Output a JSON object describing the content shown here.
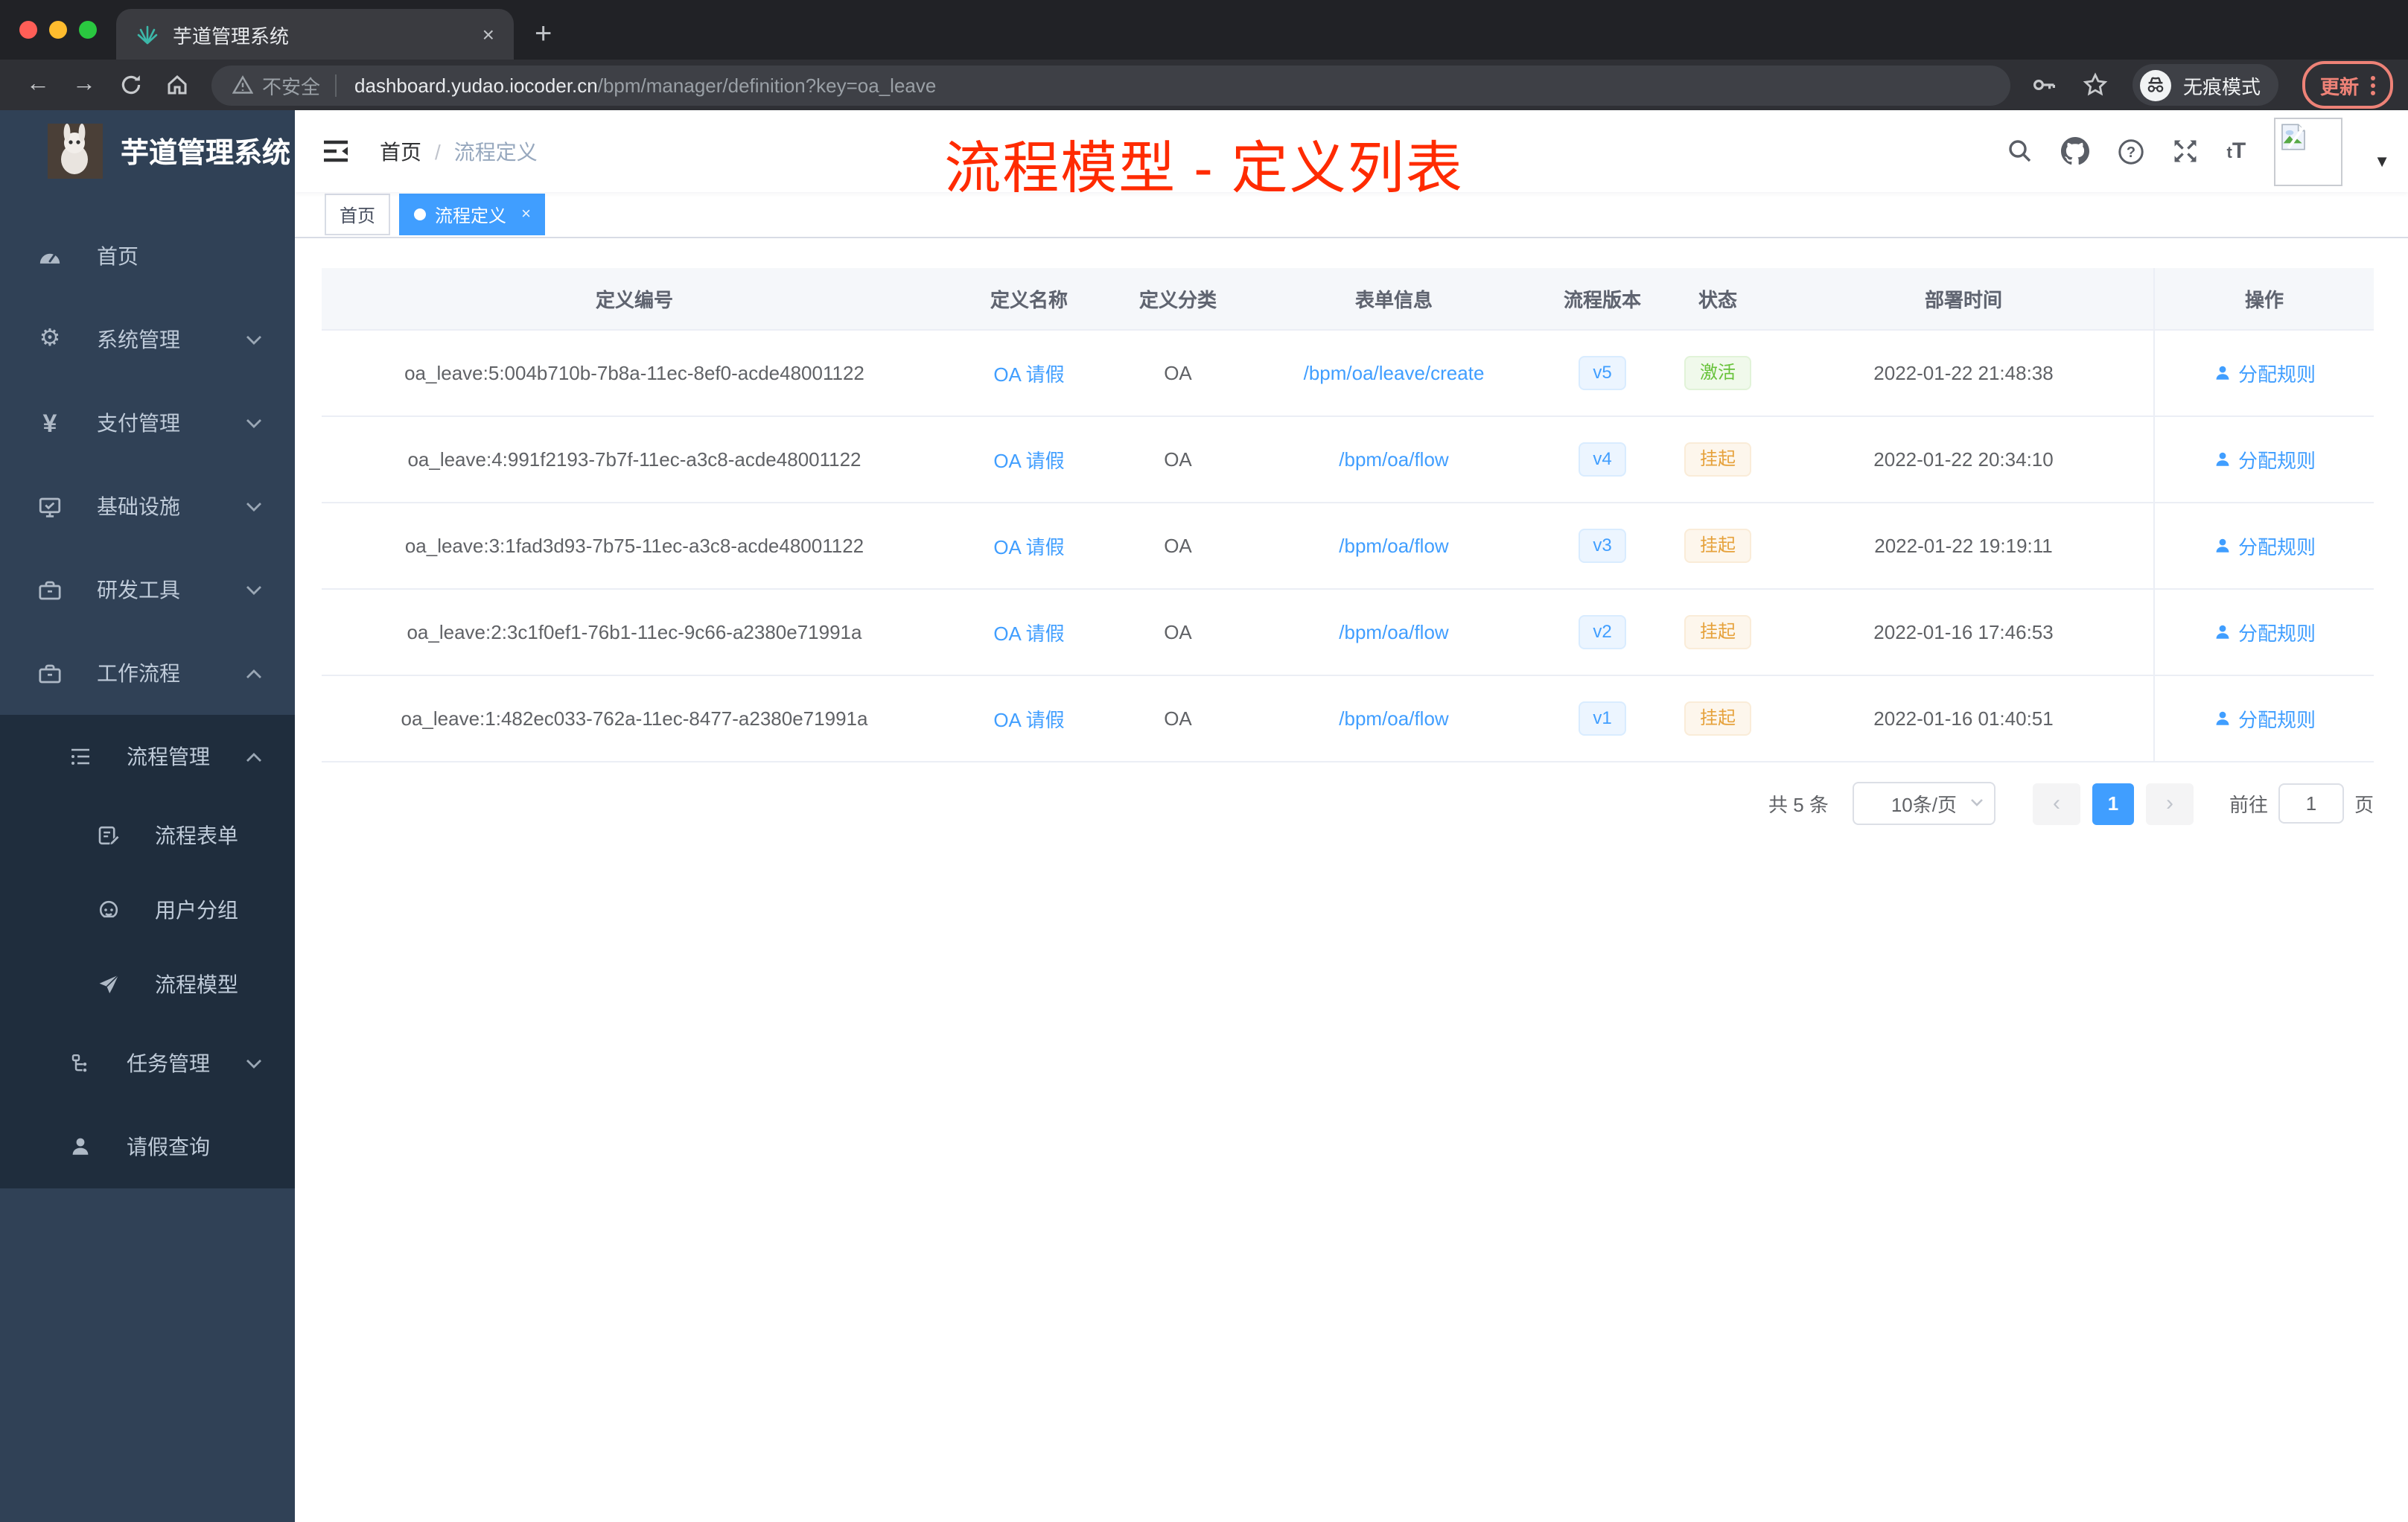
{
  "browser": {
    "tab": {
      "title": "芋道管理系统",
      "close": "×",
      "new_tab": "+"
    },
    "nav": {
      "back": "←",
      "forward": "→"
    },
    "address": {
      "security": "不安全",
      "host": "dashboard.yudao.iocoder.cn",
      "path": "/bpm/manager/definition?key=oa_leave"
    },
    "incognito_label": "无痕模式",
    "update_label": "更新"
  },
  "sidebar": {
    "title": "芋道管理系统",
    "items": [
      {
        "label": "首页"
      },
      {
        "label": "系统管理"
      },
      {
        "label": "支付管理"
      },
      {
        "label": "基础设施"
      },
      {
        "label": "研发工具"
      },
      {
        "label": "工作流程"
      }
    ],
    "workflow_children": [
      {
        "label": "流程管理"
      },
      {
        "label": "流程表单"
      },
      {
        "label": "用户分组"
      },
      {
        "label": "流程模型"
      },
      {
        "label": "任务管理"
      },
      {
        "label": "请假查询"
      }
    ]
  },
  "header": {
    "breadcrumb": [
      "首页",
      "流程定义"
    ],
    "breadcrumb_sep": "/",
    "overlay_title": "流程模型 - 定义列表",
    "font_icon": "tT"
  },
  "tags": {
    "home": "首页",
    "active": "流程定义",
    "close": "×"
  },
  "table": {
    "columns": [
      "定义编号",
      "定义名称",
      "定义分类",
      "表单信息",
      "流程版本",
      "状态",
      "部署时间",
      "操作"
    ],
    "action_label": "分配规则",
    "rows": [
      {
        "id": "oa_leave:5:004b710b-7b8a-11ec-8ef0-acde48001122",
        "name": "OA 请假",
        "category": "OA",
        "form": "/bpm/oa/leave/create",
        "version": "v5",
        "status": "激活",
        "status_type": "success",
        "time": "2022-01-22 21:48:38"
      },
      {
        "id": "oa_leave:4:991f2193-7b7f-11ec-a3c8-acde48001122",
        "name": "OA 请假",
        "category": "OA",
        "form": "/bpm/oa/flow",
        "version": "v4",
        "status": "挂起",
        "status_type": "warning",
        "time": "2022-01-22 20:34:10"
      },
      {
        "id": "oa_leave:3:1fad3d93-7b75-11ec-a3c8-acde48001122",
        "name": "OA 请假",
        "category": "OA",
        "form": "/bpm/oa/flow",
        "version": "v3",
        "status": "挂起",
        "status_type": "warning",
        "time": "2022-01-22 19:19:11"
      },
      {
        "id": "oa_leave:2:3c1f0ef1-76b1-11ec-9c66-a2380e71991a",
        "name": "OA 请假",
        "category": "OA",
        "form": "/bpm/oa/flow",
        "version": "v2",
        "status": "挂起",
        "status_type": "warning",
        "time": "2022-01-16 17:46:53"
      },
      {
        "id": "oa_leave:1:482ec033-762a-11ec-8477-a2380e71991a",
        "name": "OA 请假",
        "category": "OA",
        "form": "/bpm/oa/flow",
        "version": "v1",
        "status": "挂起",
        "status_type": "warning",
        "time": "2022-01-16 01:40:51"
      }
    ]
  },
  "pagination": {
    "total": "共 5 条",
    "page_size": "10条/页",
    "prev": "‹",
    "page": "1",
    "next": "›",
    "goto": "前往",
    "goto_value": "1",
    "unit": "页"
  },
  "colors": {
    "accent": "#409eff",
    "success": "#67c23a",
    "warning": "#e6a23c",
    "title_red": "#ff2b00",
    "sidebar_bg": "#304156",
    "submenu_bg": "#1f2d3d"
  }
}
